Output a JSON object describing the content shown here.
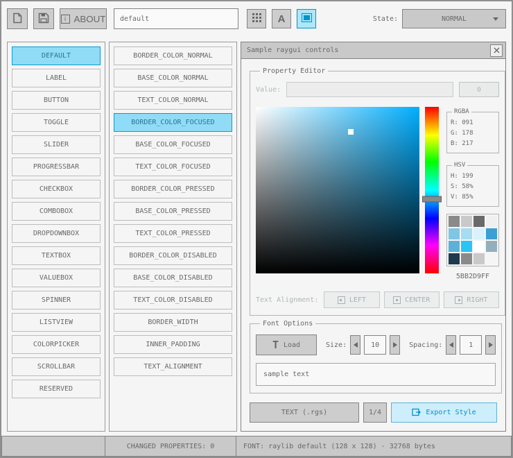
{
  "toolbar": {
    "about_label": "ABOUT",
    "info_glyph": "i",
    "font_glyph": "A",
    "style_name": "default",
    "state_label": "State:",
    "state_value": "NORMAL"
  },
  "controls_list": {
    "selected": "DEFAULT",
    "items": [
      "DEFAULT",
      "LABEL",
      "BUTTON",
      "TOGGLE",
      "SLIDER",
      "PROGRESSBAR",
      "CHECKBOX",
      "COMBOBOX",
      "DROPDOWNBOX",
      "TEXTBOX",
      "VALUEBOX",
      "SPINNER",
      "LISTVIEW",
      "COLORPICKER",
      "SCROLLBAR",
      "RESERVED"
    ]
  },
  "properties_list": {
    "selected": "BORDER_COLOR_FOCUSED",
    "items": [
      "BORDER_COLOR_NORMAL",
      "BASE_COLOR_NORMAL",
      "TEXT_COLOR_NORMAL",
      "BORDER_COLOR_FOCUSED",
      "BASE_COLOR_FOCUSED",
      "TEXT_COLOR_FOCUSED",
      "BORDER_COLOR_PRESSED",
      "BASE_COLOR_PRESSED",
      "TEXT_COLOR_PRESSED",
      "BORDER_COLOR_DISABLED",
      "BASE_COLOR_DISABLED",
      "TEXT_COLOR_DISABLED",
      "BORDER_WIDTH",
      "INNER_PADDING",
      "TEXT_ALIGNMENT"
    ]
  },
  "sample_window": {
    "title": "Sample raygui controls",
    "property_editor": {
      "group_label": "Property Editor",
      "value_label": "Value:",
      "value_text": "",
      "value_button_label": "0",
      "rgba": {
        "label": "RGBA",
        "r": "R: 091",
        "g": "G: 178",
        "b": "B: 217"
      },
      "hsv": {
        "label": "HSV",
        "h": "H: 199",
        "s": "S: 58%",
        "v": "V: 85%"
      },
      "hex_value": "5BB2D9FF",
      "selected_color": "#5BB2D9",
      "palette": [
        "#8A8A8A",
        "#C9C9C9",
        "#6A6A6A",
        "#F0F0F0",
        "#7FC6E3",
        "#A5DCF2",
        "#D9F2FB",
        "#3D9ED2",
        "#5BB2D9",
        "#29C5F4",
        "#FFFFFF",
        "#93AFBD",
        "#1E3A4C",
        "#8A8A8A",
        "#C9C9C9",
        "#F5F5F5"
      ],
      "text_alignment_label": "Text Alignment:",
      "alignment_options": [
        "LEFT",
        "CENTER",
        "RIGHT"
      ]
    },
    "font_options": {
      "group_label": "Font Options",
      "load_icon_glyph": "T",
      "load_button_label": "Load",
      "size_label": "Size:",
      "size_value": "10",
      "spacing_label": "Spacing:",
      "spacing_value": "1",
      "sample_text": "sample text"
    },
    "export_bar": {
      "format_button_label": "TEXT (.rgs)",
      "page_button_label": "1/4",
      "export_button_label": "Export Style"
    }
  },
  "statusbar": {
    "changed_properties": "CHANGED PROPERTIES: 0",
    "font_info": "FONT: raylib default (128 x 128) - 32768 bytes"
  },
  "colors": {
    "accent_border": "#0492C7",
    "accent_fill": "#97E8FF",
    "focused_border": "#5BB2D9",
    "border_normal": "#838383",
    "base_normal": "#C9C9C9",
    "text_normal": "#686868"
  }
}
